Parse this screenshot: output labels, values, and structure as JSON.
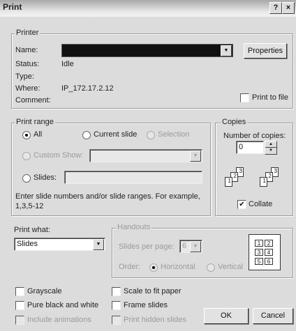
{
  "dialog": {
    "title": "Print",
    "help_glyph": "?",
    "close_glyph": "×"
  },
  "printer": {
    "legend": "Printer",
    "name_label": "Name:",
    "properties_label": "Properties",
    "status_label": "Status:",
    "status_value": "Idle",
    "type_label": "Type:",
    "type_value": "",
    "where_label": "Where:",
    "where_value": "IP_172.17.2.12",
    "comment_label": "Comment:",
    "comment_value": "",
    "print_to_file_label": "Print to file",
    "print_to_file_checked": false
  },
  "print_range": {
    "legend": "Print range",
    "all_label": "All",
    "current_slide_label": "Current slide",
    "selection_label": "Selection",
    "custom_show_label": "Custom Show:",
    "slides_label": "Slides:",
    "hint": "Enter slide numbers and/or slide ranges. For example,",
    "hint_example": "1,3,5-12",
    "selected": "all"
  },
  "copies": {
    "legend": "Copies",
    "number_label": "Number of copies:",
    "number_value": "0",
    "collate_label": "Collate",
    "collate_checked": true
  },
  "print_what": {
    "label": "Print what:",
    "value": "Slides"
  },
  "handouts": {
    "legend": "Handouts",
    "slides_per_page_label": "Slides per page:",
    "slides_per_page_value": "6",
    "order_label": "Order:",
    "horizontal_label": "Horizontal",
    "vertical_label": "Vertical",
    "preview_numbers": [
      "1",
      "2",
      "3",
      "4",
      "5",
      "6"
    ]
  },
  "options": {
    "grayscale": "Grayscale",
    "pure_bw": "Pure black and white",
    "include_animations": "Include animations",
    "scale_to_fit": "Scale to fit paper",
    "frame_slides": "Frame slides",
    "print_hidden": "Print hidden slides"
  },
  "buttons": {
    "ok": "OK",
    "cancel": "Cancel"
  },
  "icons": {
    "arrow_down": "▼",
    "spin_up": "▲",
    "spin_down": "▼",
    "check": "✔"
  }
}
